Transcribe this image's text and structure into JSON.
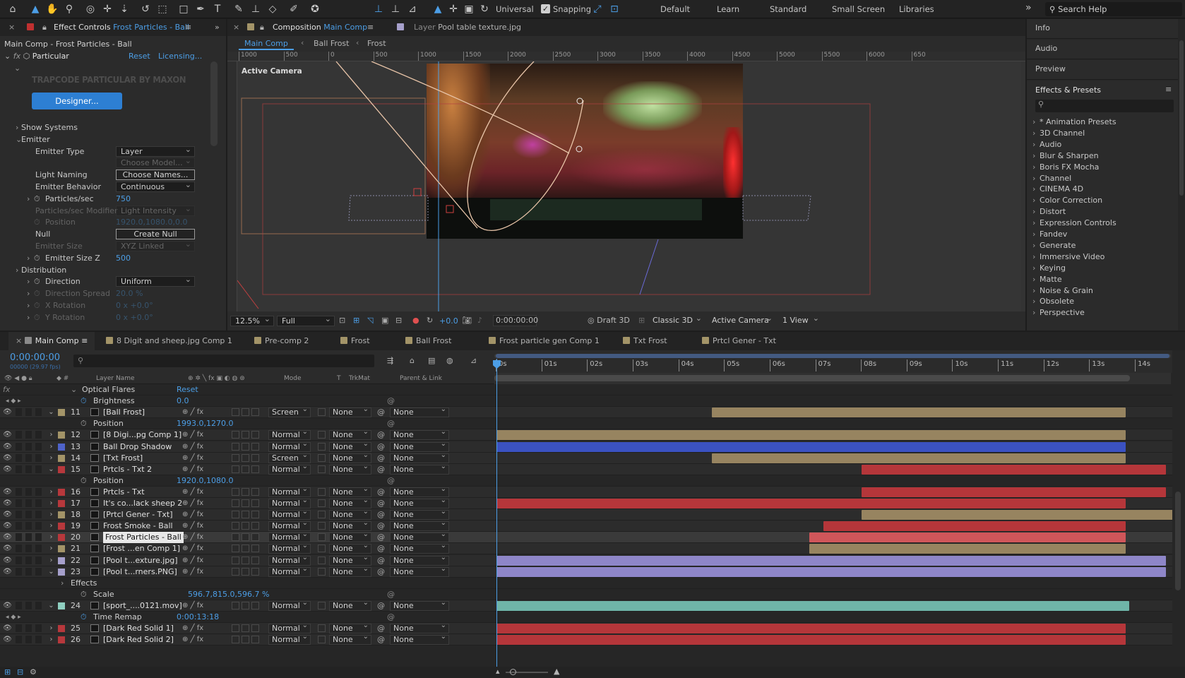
{
  "toolbar": {
    "universal_label": "Universal",
    "snapping_label": "Snapping",
    "workspaces": [
      "Default",
      "Learn",
      "Standard",
      "Small Screen",
      "Libraries"
    ],
    "search_placeholder": "Search Help",
    "more_glyph": "»"
  },
  "effect_controls": {
    "tab_label": "Effect Controls",
    "tab_target": "Frost Particles - Ball",
    "breadcrumb": "Main Comp - Frost Particles - Ball",
    "effect_name": "Particular",
    "reset_label": "Reset",
    "licensing_label": "Licensing...",
    "logo_text": "TRAPCODE PARTICULAR BY MAXON",
    "designer_button": "Designer...",
    "props": [
      {
        "label": "Show Systems",
        "type": "group"
      },
      {
        "label": "Emitter",
        "type": "group-open"
      },
      {
        "label": "Emitter Type",
        "type": "dropdown",
        "value": "Layer"
      },
      {
        "label": "",
        "type": "dropdown-disabled",
        "value": "Choose Model..."
      },
      {
        "label": "Light Naming",
        "type": "button",
        "value": "Choose Names..."
      },
      {
        "label": "Emitter Behavior",
        "type": "dropdown",
        "value": "Continuous"
      },
      {
        "label": "Particles/sec",
        "type": "number",
        "value": "750"
      },
      {
        "label": "Particles/sec Modifier",
        "type": "dropdown-disabled",
        "value": "Light Intensity"
      },
      {
        "label": "Position",
        "type": "number-disabled",
        "value": "1920.0,1080.0,0.0"
      },
      {
        "label": "Null",
        "type": "button",
        "value": "Create Null"
      },
      {
        "label": "Emitter Size",
        "type": "dropdown-disabled",
        "value": "XYZ Linked"
      },
      {
        "label": "Emitter Size Z",
        "type": "number",
        "value": "500"
      },
      {
        "label": "Distribution",
        "type": "group"
      },
      {
        "label": "Direction",
        "type": "dropdown",
        "value": "Uniform"
      },
      {
        "label": "Direction Spread",
        "type": "number-disabled",
        "value": "20.0 %"
      },
      {
        "label": "X Rotation",
        "type": "number-disabled",
        "value": "0 x +0.0°"
      },
      {
        "label": "Y Rotation",
        "type": "number-disabled",
        "value": "0 x +0.0°"
      }
    ]
  },
  "composition": {
    "tab_label": "Composition",
    "tab_target": "Main Comp",
    "layer_tab_label": "Layer",
    "layer_tab_target": "Pool table texture.jpg",
    "crumbs": [
      "Main Comp",
      "Ball Frost",
      "Frost"
    ],
    "ruler_labels": [
      "1000",
      "500",
      "0",
      "500",
      "1000",
      "1500",
      "2000",
      "2500",
      "3000",
      "3500",
      "4000",
      "4500",
      "5000",
      "5500",
      "6000",
      "650"
    ],
    "camera_label": "Active Camera",
    "footer": {
      "zoom": "12.5%",
      "resolution": "Full",
      "exposure": "+0.0",
      "timecode": "0:00:00:00",
      "draft": "Draft 3D",
      "renderer": "Classic 3D",
      "camera": "Active Camera",
      "views": "1 View"
    }
  },
  "right_panel": {
    "sections": [
      "Info",
      "Audio",
      "Preview"
    ],
    "effects_title": "Effects & Presets",
    "categories": [
      "* Animation Presets",
      "3D Channel",
      "Audio",
      "Blur & Sharpen",
      "Boris FX Mocha",
      "Channel",
      "CINEMA 4D",
      "Color Correction",
      "Distort",
      "Expression Controls",
      "Fandev",
      "Generate",
      "Immersive Video",
      "Keying",
      "Matte",
      "Noise & Grain",
      "Obsolete",
      "Perspective"
    ]
  },
  "timeline": {
    "tabs": [
      {
        "label": "Main Comp",
        "color": "#8a8a8a",
        "active": true
      },
      {
        "label": "8 Digit and sheep.jpg Comp 1",
        "color": "#a39468"
      },
      {
        "label": "Pre-comp 2",
        "color": "#a39468"
      },
      {
        "label": "Frost",
        "color": "#a39468"
      },
      {
        "label": "Ball Frost",
        "color": "#a39468"
      },
      {
        "label": "Frost particle gen Comp 1",
        "color": "#a39468"
      },
      {
        "label": "Txt Frost",
        "color": "#a39468"
      },
      {
        "label": "Prtcl Gener - Txt",
        "color": "#a39468"
      }
    ],
    "timecode": "0:00:00:00",
    "timecode_sub": "00000 (29.97 fps)",
    "columns": {
      "layer_name": "Layer Name",
      "mode": "Mode",
      "t": "T",
      "trkmat": "TrkMat",
      "parent": "Parent & Link"
    },
    "ruler": [
      "0s",
      "01s",
      "02s",
      "03s",
      "04s",
      "05s",
      "06s",
      "07s",
      "08s",
      "09s",
      "10s",
      "11s",
      "12s",
      "13s",
      "14s"
    ],
    "rows": [
      {
        "kind": "fx",
        "label": "Optical Flares",
        "extra": "Reset"
      },
      {
        "kind": "prop",
        "label": "Brightness",
        "value": "0.0"
      },
      {
        "kind": "layer",
        "num": "11",
        "name": "[Ball Frost]",
        "color": "#a39468",
        "mode": "Screen",
        "trk": "None",
        "parent": "None",
        "bar_start": 0.318,
        "bar_end": 0.93,
        "bar_color": "#978460",
        "expanded": true
      },
      {
        "kind": "prop",
        "label": "Position",
        "value": "1993.0,1270.0"
      },
      {
        "kind": "layer",
        "num": "12",
        "name": "[8 Digi...pg Comp 1]",
        "color": "#a39468",
        "mode": "Normal",
        "trk": "None",
        "parent": "None",
        "bar_start": 0.0,
        "bar_end": 0.93,
        "bar_color": "#978460"
      },
      {
        "kind": "layer",
        "num": "13",
        "name": "Ball Drop Shadow",
        "color": "#4f63c9",
        "mode": "Normal",
        "trk": "None",
        "parent": "None",
        "bar_start": 0.0,
        "bar_end": 0.93,
        "bar_color": "#3b52c2"
      },
      {
        "kind": "layer",
        "num": "14",
        "name": "[Txt Frost]",
        "color": "#a39468",
        "mode": "Screen",
        "trk": "None",
        "parent": "None",
        "bar_start": 0.318,
        "bar_end": 0.93,
        "bar_color": "#978460"
      },
      {
        "kind": "layer",
        "num": "15",
        "name": "Prtcls - Txt 2",
        "color": "#b7383c",
        "mode": "Normal",
        "trk": "None",
        "parent": "None",
        "bar_start": 0.54,
        "bar_end": 0.99,
        "bar_color": "#b5363a",
        "expanded": true
      },
      {
        "kind": "prop",
        "label": "Position",
        "value": "1920.0,1080.0"
      },
      {
        "kind": "layer",
        "num": "16",
        "name": "Prtcls - Txt",
        "color": "#b7383c",
        "mode": "Normal",
        "trk": "None",
        "parent": "None",
        "bar_start": 0.54,
        "bar_end": 0.99,
        "bar_color": "#b5363a"
      },
      {
        "kind": "layer",
        "num": "17",
        "name": "It's co...lack sheep 2",
        "color": "#b7383c",
        "mode": "Normal",
        "trk": "None",
        "parent": "None",
        "bar_start": 0.0,
        "bar_end": 0.93,
        "bar_color": "#b5363a"
      },
      {
        "kind": "layer",
        "num": "18",
        "name": "[Prtcl Gener - Txt]",
        "color": "#a39468",
        "mode": "Normal",
        "trk": "None",
        "parent": "None",
        "bar_start": 0.54,
        "bar_end": 1.0,
        "bar_color": "#978460"
      },
      {
        "kind": "layer",
        "num": "19",
        "name": "Frost Smoke - Ball",
        "color": "#b7383c",
        "mode": "Normal",
        "trk": "None",
        "parent": "None",
        "bar_start": 0.483,
        "bar_end": 0.93,
        "bar_color": "#b5363a"
      },
      {
        "kind": "layer",
        "num": "20",
        "name": "Frost Particles - Ball",
        "color": "#b7383c",
        "mode": "Normal",
        "trk": "None",
        "parent": "None",
        "bar_start": 0.462,
        "bar_end": 0.93,
        "bar_color": "#d0565a",
        "selected": true
      },
      {
        "kind": "layer",
        "num": "21",
        "name": "[Frost ...en Comp 1]",
        "color": "#a39468",
        "mode": "Normal",
        "trk": "None",
        "parent": "None",
        "bar_start": 0.462,
        "bar_end": 0.93,
        "bar_color": "#978460"
      },
      {
        "kind": "layer",
        "num": "22",
        "name": "[Pool t...exture.jpg]",
        "color": "#a6a0cc",
        "mode": "Normal",
        "trk": "None",
        "parent": "None",
        "bar_start": 0.0,
        "bar_end": 0.99,
        "bar_color": "#8e86c8"
      },
      {
        "kind": "layer",
        "num": "23",
        "name": "[Pool t...rners.PNG]",
        "color": "#a6a0cc",
        "mode": "Normal",
        "trk": "None",
        "parent": "None",
        "bar_start": 0.0,
        "bar_end": 0.99,
        "bar_color": "#8e86c8",
        "expanded": true
      },
      {
        "kind": "group",
        "label": "Effects"
      },
      {
        "kind": "prop",
        "label": "Scale",
        "value": "596.7,815.0,596.7 %"
      },
      {
        "kind": "layer",
        "num": "24",
        "name": "[sport_....0121.mov]",
        "color": "#8fcfc0",
        "mode": "Normal",
        "trk": "None",
        "parent": "None",
        "bar_start": 0.0,
        "bar_end": 0.935,
        "bar_color": "#6fb5a8",
        "expanded": true
      },
      {
        "kind": "prop",
        "label": "Time Remap",
        "value": "0:00:13:18"
      },
      {
        "kind": "layer",
        "num": "25",
        "name": "[Dark Red Solid 1]",
        "color": "#b7383c",
        "mode": "Normal",
        "trk": "None",
        "parent": "None",
        "bar_start": 0.0,
        "bar_end": 0.93,
        "bar_color": "#b5363a"
      },
      {
        "kind": "layer",
        "num": "26",
        "name": "[Dark Red Solid 2]",
        "color": "#b7383c",
        "mode": "Normal",
        "trk": "None",
        "parent": "None",
        "bar_start": 0.0,
        "bar_end": 0.93,
        "bar_color": "#b5363a"
      }
    ]
  },
  "colors": {
    "accent": "#4c9ee6",
    "panel": "#2b2b2b",
    "tabbar": "#232323"
  }
}
